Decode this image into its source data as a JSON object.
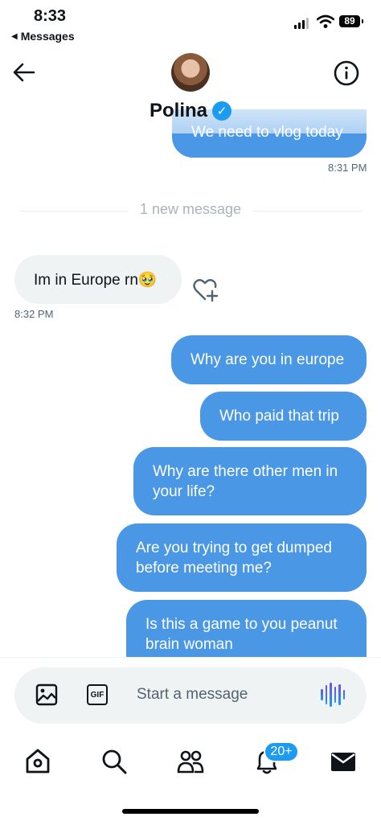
{
  "status_bar": {
    "time": "8:33",
    "back_app": "Messages",
    "battery": "89"
  },
  "header": {
    "name": "Polina",
    "verified_mark": "✓"
  },
  "messages": {
    "partial_outgoing": "We need to vlog today",
    "partial_time": "8:31 PM",
    "new_divider": "1 new message",
    "incoming_text": "Im in Europe rn🥹",
    "incoming_time": "8:32 PM",
    "outgoing": [
      "Why are you in europe",
      "Who paid that trip",
      "Why are there other men in your life?",
      "Are you trying to get dumped before meeting me?",
      "Is this a game to you peanut brain woman"
    ]
  },
  "composer": {
    "placeholder": "Start a message",
    "gif_label": "GIF"
  },
  "tab_bar": {
    "notification_badge": "20+"
  },
  "icons": [
    "back-arrow-icon",
    "info-icon",
    "verified-icon",
    "heart-plus-icon",
    "image-icon",
    "gif-icon",
    "voice-icon",
    "home-icon",
    "search-icon",
    "people-icon",
    "bell-icon",
    "mail-icon"
  ],
  "colors": {
    "accent": "#1d9bf0",
    "outgoing_bubble": "#4a97e6",
    "incoming_bubble": "#eff3f4"
  }
}
